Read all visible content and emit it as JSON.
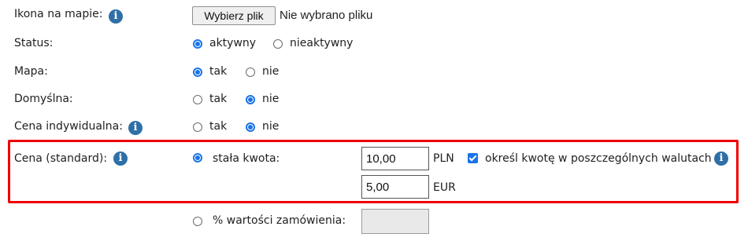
{
  "rows": {
    "icon": {
      "label": "Ikona na mapie:",
      "button": "Wybierz plik",
      "file_status": "Nie wybrano pliku"
    },
    "status": {
      "label": "Status:",
      "option_active": "aktywny",
      "option_inactive": "nieaktywny",
      "selected": "aktywny"
    },
    "map": {
      "label": "Mapa:",
      "option_yes": "tak",
      "option_no": "nie",
      "selected": "tak"
    },
    "default": {
      "label": "Domyślna:",
      "option_yes": "tak",
      "option_no": "nie",
      "selected": "nie"
    },
    "individual_price": {
      "label": "Cena indywidualna:",
      "option_yes": "tak",
      "option_no": "nie",
      "selected": "nie"
    },
    "standard_price": {
      "label": "Cena (standard):",
      "fixed_amount_label": "stała kwota:",
      "fixed_amount_selected": true,
      "pln_value": "10,00",
      "pln_currency": "PLN",
      "per_currency_label": "określ kwotę w poszczególnych walutach",
      "per_currency_checked": true,
      "eur_value": "5,00",
      "eur_currency": "EUR",
      "percent_label": "% wartości zamówienia:",
      "percent_selected": false,
      "percent_value": ""
    }
  },
  "icons": {
    "info": "info-icon"
  },
  "colors": {
    "accent": "#1a73e8",
    "info": "#2f6fa7",
    "highlight": "#ee0000"
  }
}
